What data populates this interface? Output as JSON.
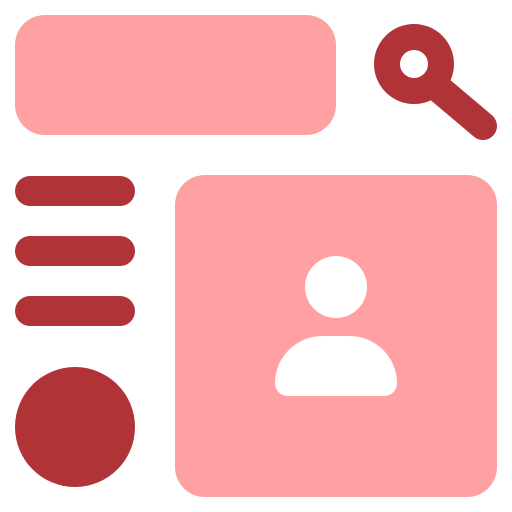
{
  "colors": {
    "light": "#ffa1a3",
    "dark": "#b03337",
    "white": "#ffffff"
  },
  "icons": {
    "search": "search-icon",
    "menu": "hamburger-menu-icon",
    "profile": "user-avatar-icon"
  }
}
